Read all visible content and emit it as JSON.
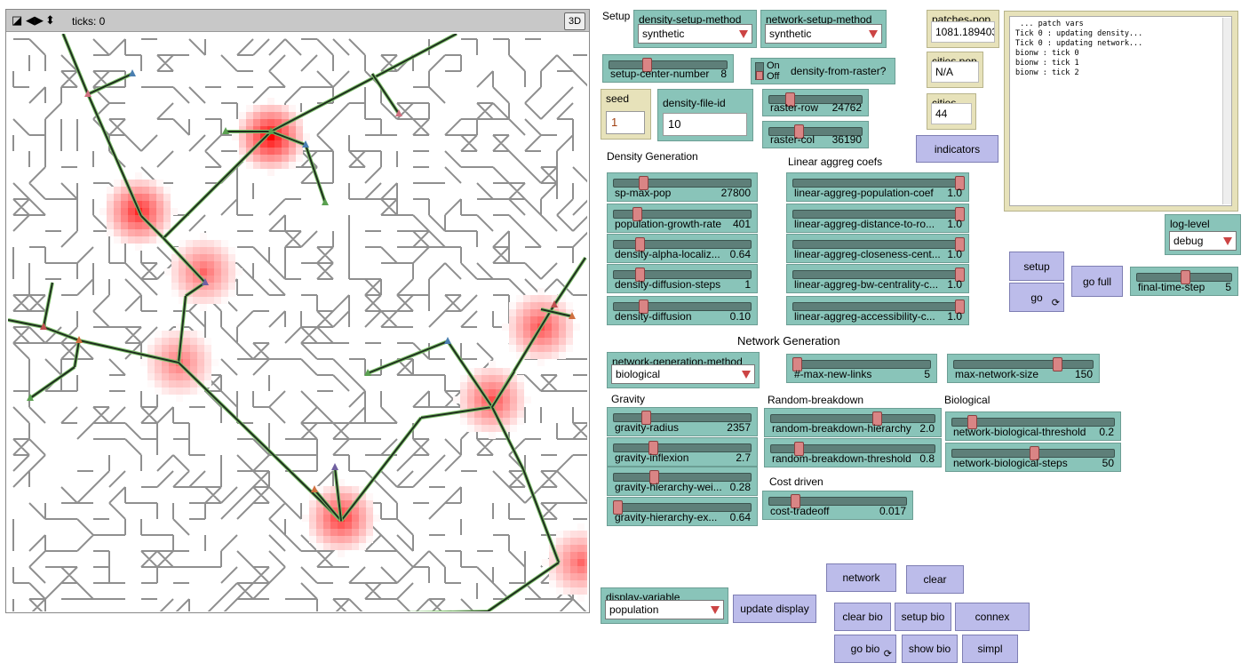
{
  "view": {
    "ticks_label": "ticks: 0",
    "btn_3d": "3D",
    "ctl_icons": [
      "speed-icon",
      "step-arrows-icon",
      "up-down-icon"
    ]
  },
  "setup_label": "Setup",
  "choosers": {
    "density_setup_method": {
      "label": "density-setup-method",
      "value": "synthetic"
    },
    "network_setup_method": {
      "label": "network-setup-method",
      "value": "synthetic"
    },
    "network_generation_method": {
      "label": "network-generation-method",
      "value": "biological"
    },
    "log_level": {
      "label": "log-level",
      "value": "debug"
    },
    "display_variable": {
      "label": "display-variable",
      "value": "population"
    }
  },
  "switch": {
    "on": "On",
    "off": "Off",
    "label": "density-from-raster?"
  },
  "monitors": {
    "patches_pop": {
      "label": "patches-pop",
      "value": "1081.189403"
    },
    "cities_pop": {
      "label": "cities pop",
      "value": "N/A"
    },
    "cities": {
      "label": "cities",
      "value": "44"
    }
  },
  "inputs": {
    "seed": {
      "label": "seed",
      "value": "1"
    },
    "density_file_id": {
      "label": "density-file-id",
      "value": "10"
    }
  },
  "sections": {
    "density_generation": "Density Generation",
    "linear_aggreg": "Linear aggreg coefs",
    "network_generation": "Network Generation",
    "gravity": "Gravity",
    "random_breakdown": "Random-breakdown",
    "biological": "Biological",
    "cost_driven": "Cost driven"
  },
  "sliders": {
    "setup_center_number": {
      "name": "setup-center-number",
      "value": "8",
      "pos": 0.3
    },
    "raster_row": {
      "name": "raster-row",
      "value": "24762",
      "pos": 0.2
    },
    "raster_col": {
      "name": "raster-col",
      "value": "36190",
      "pos": 0.3
    },
    "sp_max_pop": {
      "name": "sp-max-pop",
      "value": "27800",
      "pos": 0.2
    },
    "population_growth_rate": {
      "name": "population-growth-rate",
      "value": "401",
      "pos": 0.15
    },
    "density_alpha": {
      "name": "density-alpha-localiz...",
      "value": "0.64",
      "pos": 0.17
    },
    "density_diffusion_steps": {
      "name": "density-diffusion-steps",
      "value": "1",
      "pos": 0.17
    },
    "density_diffusion": {
      "name": "density-diffusion",
      "value": "0.10",
      "pos": 0.2
    },
    "la_population": {
      "name": "linear-aggreg-population-coef",
      "value": "1.0",
      "pos": 1.0
    },
    "la_distance": {
      "name": "linear-aggreg-distance-to-ro...",
      "value": "1.0",
      "pos": 1.0
    },
    "la_closeness": {
      "name": "linear-aggreg-closeness-cent...",
      "value": "1.0",
      "pos": 1.0
    },
    "la_bw": {
      "name": "linear-aggreg-bw-centrality-c...",
      "value": "1.0",
      "pos": 1.0
    },
    "la_access": {
      "name": "linear-aggreg-accessibility-c...",
      "value": "1.0",
      "pos": 1.0
    },
    "final_time_step": {
      "name": "final-time-step",
      "value": "5",
      "pos": 0.5
    },
    "max_new_links": {
      "name": "#-max-new-links",
      "value": "5",
      "pos": 0.0
    },
    "max_network_size": {
      "name": "max-network-size",
      "value": "150",
      "pos": 0.75
    },
    "gravity_radius": {
      "name": "gravity-radius",
      "value": "2357",
      "pos": 0.22
    },
    "gravity_inflexion": {
      "name": "gravity-inflexion",
      "value": "2.7",
      "pos": 0.27
    },
    "gravity_hier_wei": {
      "name": "gravity-hierarchy-wei...",
      "value": "0.28",
      "pos": 0.28
    },
    "gravity_hier_ex": {
      "name": "gravity-hierarchy-ex...",
      "value": "0.64",
      "pos": 0.0
    },
    "rb_hierarchy": {
      "name": "random-breakdown-hierarchy",
      "value": "2.0",
      "pos": 0.65
    },
    "rb_threshold": {
      "name": "random-breakdown-threshold",
      "value": "0.8",
      "pos": 0.15
    },
    "bio_threshold": {
      "name": "network-biological-threshold",
      "value": "0.2",
      "pos": 0.1
    },
    "bio_steps": {
      "name": "network-biological-steps",
      "value": "50",
      "pos": 0.5
    },
    "cost_tradeoff": {
      "name": "cost-tradeoff",
      "value": "0.017",
      "pos": 0.17
    }
  },
  "buttons": {
    "indicators": "indicators",
    "setup": "setup",
    "go": "go",
    "go_full": "go full",
    "network": "network",
    "clear": "clear",
    "update_display": "update display",
    "clear_bio": "clear bio",
    "setup_bio": "setup bio",
    "connex": "connex",
    "go_bio": "go bio",
    "show_bio": "show bio",
    "simpl": "simpl",
    "forever_icon": "forever-icon"
  },
  "output_text": " ... patch vars\nTick 0 : updating density...\nTick 0 : updating network...\nbionw : tick 0\nbionw : tick 1\nbionw : tick 2",
  "colors": {
    "widget_green": "#89c4b9",
    "button_purple": "#bcbcea",
    "monitor_yellow": "#e7e2ba",
    "road_grey": "#8f8f8f",
    "network_dark": "#1f2e1f",
    "density_red": "#ff0000"
  }
}
